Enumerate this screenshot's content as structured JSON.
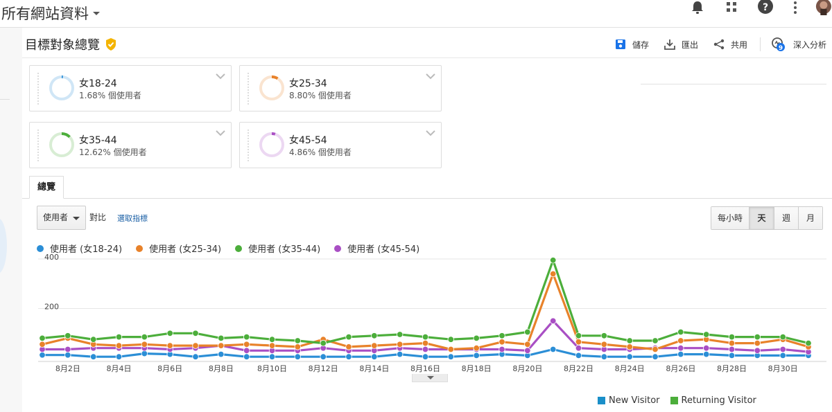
{
  "topbar": {
    "property_name": "所有網站資料"
  },
  "header": {
    "title": "目標對象總覽"
  },
  "actions": {
    "save": "儲存",
    "export": "匯出",
    "share": "共用",
    "insights": "深入分析",
    "insights_badge": "9"
  },
  "segments": [
    {
      "name": "女18-24",
      "pct_text": "1.68% 個使用者",
      "color": "#2b8ed6",
      "fraction": 0.017
    },
    {
      "name": "女25-34",
      "pct_text": "8.80% 個使用者",
      "color": "#e8822a",
      "fraction": 0.088
    },
    {
      "name": "女35-44",
      "pct_text": "12.62% 個使用者",
      "color": "#4cae3b",
      "fraction": 0.126
    },
    {
      "name": "女45-54",
      "pct_text": "4.86% 個使用者",
      "color": "#a94fc4",
      "fraction": 0.049
    }
  ],
  "tabs": {
    "overview": "總覽"
  },
  "controls": {
    "metric": "使用者",
    "versus": "對比",
    "select_metric": "選取指標"
  },
  "period": {
    "hour": "每小時",
    "day": "天",
    "week": "週",
    "month": "月",
    "active": "day"
  },
  "legend": [
    {
      "label": "使用者 (女18-24)",
      "color": "#2b8ed6"
    },
    {
      "label": "使用者 (女25-34)",
      "color": "#e8822a"
    },
    {
      "label": "使用者 (女35-44)",
      "color": "#4cae3b"
    },
    {
      "label": "使用者 (女45-54)",
      "color": "#a94fc4"
    }
  ],
  "bottom_legend": [
    {
      "label": "New Visitor",
      "color": "#1a8fc9"
    },
    {
      "label": "Returning Visitor",
      "color": "#4cae3b"
    }
  ],
  "chart_data": {
    "type": "line",
    "x": [
      "8月1日",
      "8月2日",
      "8月3日",
      "8月4日",
      "8月5日",
      "8月6日",
      "8月7日",
      "8月8日",
      "8月9日",
      "8月10日",
      "8月11日",
      "8月12日",
      "8月13日",
      "8月14日",
      "8月15日",
      "8月16日",
      "8月17日",
      "8月18日",
      "8月19日",
      "8月20日",
      "8月21日",
      "8月22日",
      "8月23日",
      "8月24日",
      "8月25日",
      "8月26日",
      "8月27日",
      "8月28日",
      "8月29日",
      "8月30日",
      "8月31日"
    ],
    "x_tick_labels": [
      "8月2日",
      "8月4日",
      "8月6日",
      "8月8日",
      "8月10日",
      "8月12日",
      "8月14日",
      "8月16日",
      "8月18日",
      "8月20日",
      "8月22日",
      "8月24日",
      "8月26日",
      "8月28日",
      "8月30日"
    ],
    "ylim": [
      0,
      400
    ],
    "y_ticks": [
      200,
      400
    ],
    "series": [
      {
        "name": "使用者 (女18-24)",
        "color": "#2b8ed6",
        "values": [
          12,
          12,
          5,
          5,
          18,
          15,
          5,
          15,
          5,
          5,
          5,
          5,
          5,
          5,
          15,
          5,
          5,
          10,
          15,
          10,
          35,
          10,
          5,
          5,
          5,
          15,
          15,
          10,
          10,
          10,
          10
        ]
      },
      {
        "name": "使用者 (女25-34)",
        "color": "#e8822a",
        "values": [
          55,
          80,
          55,
          50,
          55,
          50,
          50,
          50,
          55,
          50,
          45,
          75,
          45,
          50,
          55,
          60,
          35,
          40,
          65,
          55,
          340,
          65,
          55,
          45,
          35,
          70,
          75,
          60,
          60,
          75,
          45
        ]
      },
      {
        "name": "使用者 (女35-44)",
        "color": "#4cae3b",
        "values": [
          80,
          90,
          75,
          85,
          85,
          100,
          100,
          80,
          85,
          75,
          70,
          60,
          85,
          90,
          95,
          85,
          75,
          80,
          90,
          105,
          395,
          90,
          90,
          70,
          70,
          105,
          95,
          85,
          85,
          85,
          60
        ]
      },
      {
        "name": "使用者 (女45-54)",
        "color": "#a94fc4",
        "values": [
          35,
          35,
          40,
          40,
          40,
          35,
          40,
          50,
          30,
          30,
          30,
          40,
          30,
          30,
          40,
          35,
          35,
          35,
          35,
          30,
          150,
          40,
          35,
          35,
          40,
          40,
          40,
          35,
          30,
          35,
          25
        ]
      }
    ]
  }
}
